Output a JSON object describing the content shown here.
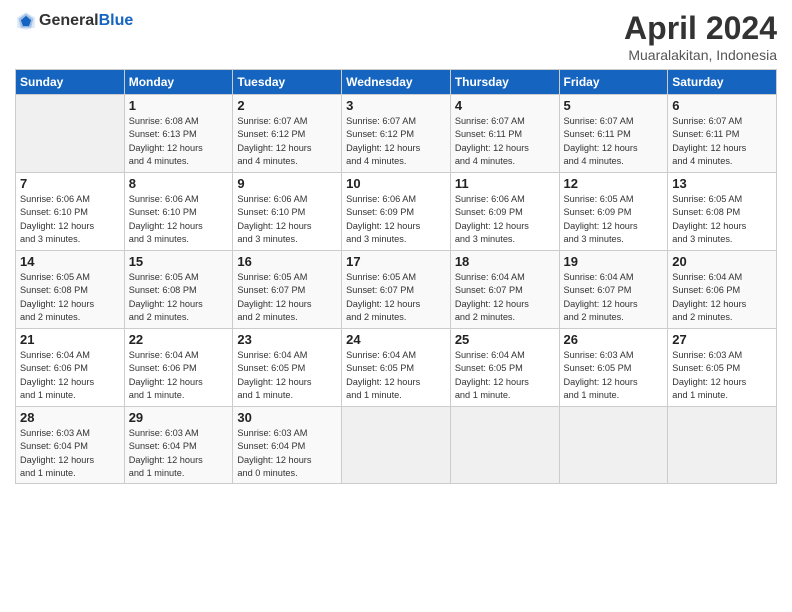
{
  "header": {
    "logo_general": "General",
    "logo_blue": "Blue",
    "title": "April 2024",
    "location": "Muaralakitan, Indonesia"
  },
  "days_of_week": [
    "Sunday",
    "Monday",
    "Tuesday",
    "Wednesday",
    "Thursday",
    "Friday",
    "Saturday"
  ],
  "weeks": [
    [
      {
        "day": "",
        "info": ""
      },
      {
        "day": "1",
        "info": "Sunrise: 6:08 AM\nSunset: 6:13 PM\nDaylight: 12 hours\nand 4 minutes."
      },
      {
        "day": "2",
        "info": "Sunrise: 6:07 AM\nSunset: 6:12 PM\nDaylight: 12 hours\nand 4 minutes."
      },
      {
        "day": "3",
        "info": "Sunrise: 6:07 AM\nSunset: 6:12 PM\nDaylight: 12 hours\nand 4 minutes."
      },
      {
        "day": "4",
        "info": "Sunrise: 6:07 AM\nSunset: 6:11 PM\nDaylight: 12 hours\nand 4 minutes."
      },
      {
        "day": "5",
        "info": "Sunrise: 6:07 AM\nSunset: 6:11 PM\nDaylight: 12 hours\nand 4 minutes."
      },
      {
        "day": "6",
        "info": "Sunrise: 6:07 AM\nSunset: 6:11 PM\nDaylight: 12 hours\nand 4 minutes."
      }
    ],
    [
      {
        "day": "7",
        "info": "Sunrise: 6:06 AM\nSunset: 6:10 PM\nDaylight: 12 hours\nand 3 minutes."
      },
      {
        "day": "8",
        "info": "Sunrise: 6:06 AM\nSunset: 6:10 PM\nDaylight: 12 hours\nand 3 minutes."
      },
      {
        "day": "9",
        "info": "Sunrise: 6:06 AM\nSunset: 6:10 PM\nDaylight: 12 hours\nand 3 minutes."
      },
      {
        "day": "10",
        "info": "Sunrise: 6:06 AM\nSunset: 6:09 PM\nDaylight: 12 hours\nand 3 minutes."
      },
      {
        "day": "11",
        "info": "Sunrise: 6:06 AM\nSunset: 6:09 PM\nDaylight: 12 hours\nand 3 minutes."
      },
      {
        "day": "12",
        "info": "Sunrise: 6:05 AM\nSunset: 6:09 PM\nDaylight: 12 hours\nand 3 minutes."
      },
      {
        "day": "13",
        "info": "Sunrise: 6:05 AM\nSunset: 6:08 PM\nDaylight: 12 hours\nand 3 minutes."
      }
    ],
    [
      {
        "day": "14",
        "info": "Sunrise: 6:05 AM\nSunset: 6:08 PM\nDaylight: 12 hours\nand 2 minutes."
      },
      {
        "day": "15",
        "info": "Sunrise: 6:05 AM\nSunset: 6:08 PM\nDaylight: 12 hours\nand 2 minutes."
      },
      {
        "day": "16",
        "info": "Sunrise: 6:05 AM\nSunset: 6:07 PM\nDaylight: 12 hours\nand 2 minutes."
      },
      {
        "day": "17",
        "info": "Sunrise: 6:05 AM\nSunset: 6:07 PM\nDaylight: 12 hours\nand 2 minutes."
      },
      {
        "day": "18",
        "info": "Sunrise: 6:04 AM\nSunset: 6:07 PM\nDaylight: 12 hours\nand 2 minutes."
      },
      {
        "day": "19",
        "info": "Sunrise: 6:04 AM\nSunset: 6:07 PM\nDaylight: 12 hours\nand 2 minutes."
      },
      {
        "day": "20",
        "info": "Sunrise: 6:04 AM\nSunset: 6:06 PM\nDaylight: 12 hours\nand 2 minutes."
      }
    ],
    [
      {
        "day": "21",
        "info": "Sunrise: 6:04 AM\nSunset: 6:06 PM\nDaylight: 12 hours\nand 1 minute."
      },
      {
        "day": "22",
        "info": "Sunrise: 6:04 AM\nSunset: 6:06 PM\nDaylight: 12 hours\nand 1 minute."
      },
      {
        "day": "23",
        "info": "Sunrise: 6:04 AM\nSunset: 6:05 PM\nDaylight: 12 hours\nand 1 minute."
      },
      {
        "day": "24",
        "info": "Sunrise: 6:04 AM\nSunset: 6:05 PM\nDaylight: 12 hours\nand 1 minute."
      },
      {
        "day": "25",
        "info": "Sunrise: 6:04 AM\nSunset: 6:05 PM\nDaylight: 12 hours\nand 1 minute."
      },
      {
        "day": "26",
        "info": "Sunrise: 6:03 AM\nSunset: 6:05 PM\nDaylight: 12 hours\nand 1 minute."
      },
      {
        "day": "27",
        "info": "Sunrise: 6:03 AM\nSunset: 6:05 PM\nDaylight: 12 hours\nand 1 minute."
      }
    ],
    [
      {
        "day": "28",
        "info": "Sunrise: 6:03 AM\nSunset: 6:04 PM\nDaylight: 12 hours\nand 1 minute."
      },
      {
        "day": "29",
        "info": "Sunrise: 6:03 AM\nSunset: 6:04 PM\nDaylight: 12 hours\nand 1 minute."
      },
      {
        "day": "30",
        "info": "Sunrise: 6:03 AM\nSunset: 6:04 PM\nDaylight: 12 hours\nand 0 minutes."
      },
      {
        "day": "",
        "info": ""
      },
      {
        "day": "",
        "info": ""
      },
      {
        "day": "",
        "info": ""
      },
      {
        "day": "",
        "info": ""
      }
    ]
  ]
}
